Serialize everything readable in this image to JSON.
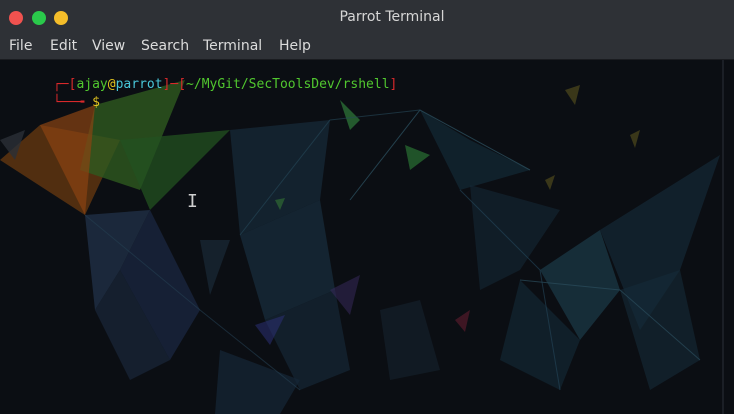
{
  "window": {
    "title": "Parrot Terminal",
    "buttons": [
      "close",
      "maximize",
      "minimize"
    ]
  },
  "menu": [
    "File",
    "Edit",
    "View",
    "Search",
    "Terminal",
    "Help"
  ],
  "prompt": {
    "open_bracket": "[",
    "user": "ajay",
    "at": "@",
    "host": "parrot",
    "close_bracket": "]",
    "dash": "─",
    "path_open": "[",
    "path": "~/MyGit/SecToolsDev/rshell",
    "path_close": "]",
    "corner": "└──╼",
    "symbol": "$"
  },
  "colors": {
    "prompt_red": "#d8292b",
    "prompt_green": "#51c72f",
    "prompt_yellow": "#e3c51f",
    "background": "#0b0e13"
  },
  "cursor_icon": "text-cursor-icon"
}
